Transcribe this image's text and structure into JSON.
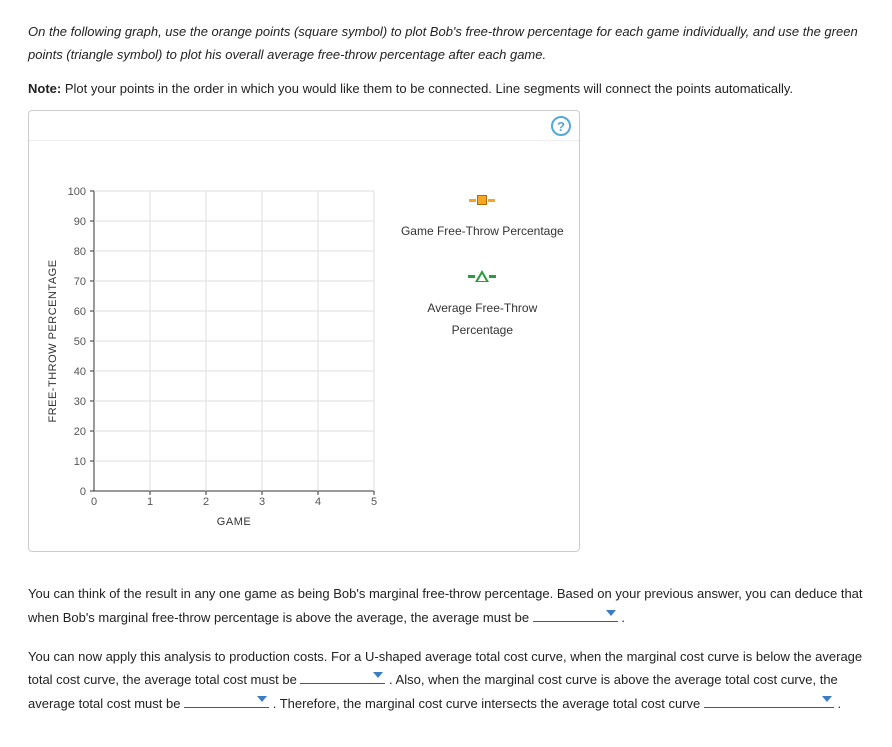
{
  "instructions": {
    "line1": "On the following graph, use the orange points (square symbol) to plot Bob's free-throw percentage for each game individually, and use the green points (triangle symbol) to plot his overall average free-throw percentage after each game.",
    "note_label": "Note:",
    "note_text": " Plot your points in the order in which you would like them to be connected. Line segments will connect the points automatically."
  },
  "help_icon": "?",
  "chart_data": {
    "type": "scatter",
    "title": "",
    "xlabel": "GAME",
    "ylabel": "FREE-THROW PERCENTAGE",
    "xlim": [
      0,
      5
    ],
    "ylim": [
      0,
      100
    ],
    "xticks": [
      0,
      1,
      2,
      3,
      4,
      5
    ],
    "yticks": [
      0,
      10,
      20,
      30,
      40,
      50,
      60,
      70,
      80,
      90,
      100
    ],
    "series": [
      {
        "name": "Game Free-Throw Percentage",
        "marker": "square",
        "color": "#f5a623",
        "values": []
      },
      {
        "name": "Average Free-Throw Percentage",
        "marker": "triangle",
        "color": "#2c9c3e",
        "values": []
      }
    ]
  },
  "legend": {
    "item1": "Game Free-Throw Percentage",
    "item2": "Average Free-Throw Percentage"
  },
  "questions": {
    "para1_a": "You can think of the result in any one game as being Bob's marginal free-throw percentage. Based on your previous answer, you can deduce that when Bob's marginal free-throw percentage is above the average, the average must be ",
    "para1_b": " .",
    "para2_a": "You can now apply this analysis to production costs. For a U-shaped average total cost curve, when the marginal cost curve is below the average total cost curve, the average total cost must be ",
    "para2_b": " . Also, when the marginal cost curve is above the average total cost curve, the average total cost must be ",
    "para2_c": " . Therefore, the marginal cost curve intersects the average total cost curve ",
    "para2_d": " ."
  }
}
